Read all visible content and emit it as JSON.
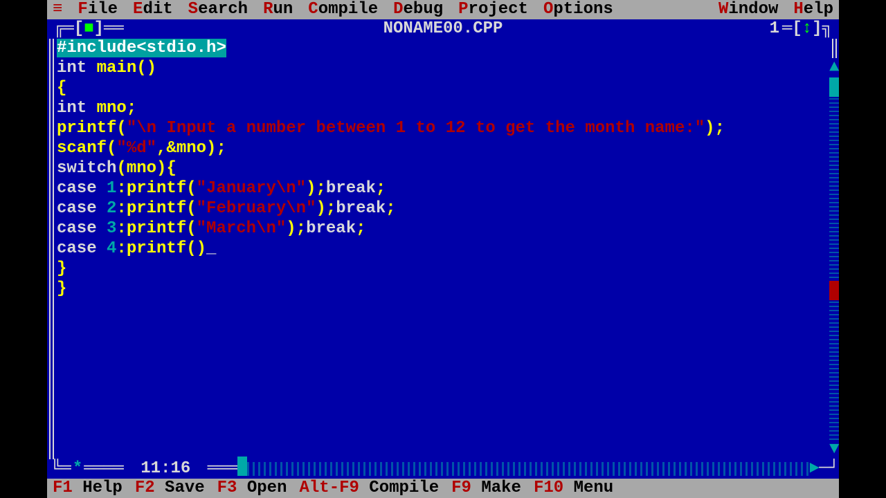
{
  "menu": {
    "items": [
      {
        "hot": "F",
        "rest": "ile"
      },
      {
        "hot": "E",
        "rest": "dit"
      },
      {
        "hot": "S",
        "rest": "earch"
      },
      {
        "hot": "R",
        "rest": "un"
      },
      {
        "hot": "C",
        "rest": "ompile"
      },
      {
        "hot": "D",
        "rest": "ebug"
      },
      {
        "hot": "P",
        "rest": "roject"
      },
      {
        "hot": "O",
        "rest": "ptions"
      }
    ],
    "right": [
      {
        "hot": "W",
        "rest": "indow"
      },
      {
        "hot": "H",
        "rest": "elp"
      }
    ]
  },
  "window": {
    "title": "NONAME00.CPP",
    "number": "1",
    "cursor_pos": "11:16"
  },
  "code": {
    "l0": {
      "text": "#include<stdio.h>"
    },
    "l1": {
      "kw": "int",
      "fn": "main",
      "sym": "()"
    },
    "l2": {
      "sym": "{"
    },
    "l3": {
      "kw": "int",
      "id": "mno",
      "sym": ";"
    },
    "l4": {
      "fn": "printf",
      "p1": "(",
      "s": "\"\\n Input a number between 1 to 12 to get the month name:\"",
      "p2": ");"
    },
    "l5": {
      "fn": "scanf",
      "p1": "(",
      "s": "\"%d\"",
      "mid": ",&mno);"
    },
    "l6": {
      "kw": "switch",
      "p1": "(",
      "id": "mno",
      "p2": "){"
    },
    "l7": {
      "kw": "case ",
      "n": "1",
      "mid": ":printf(",
      "s": "\"January\\n\"",
      "tail": ");",
      "br": "break",
      "semi": ";"
    },
    "l8": {
      "kw": "case ",
      "n": "2",
      "mid": ":printf(",
      "s": "\"February\\n\"",
      "tail": ");",
      "br": "break",
      "semi": ";"
    },
    "l9": {
      "kw": "case ",
      "n": "3",
      "mid": ":printf(",
      "s": "\"March\\n\"",
      "tail": ");",
      "br": "break",
      "semi": ";"
    },
    "l10": {
      "kw": "case ",
      "n": "4",
      "mid": ":printf()"
    },
    "l11": {
      "sym": "}"
    },
    "l12": {
      "sym": "}"
    }
  },
  "status": [
    {
      "key": "F1",
      "label": " Help"
    },
    {
      "key": "F2",
      "label": " Save"
    },
    {
      "key": "F3",
      "label": " Open"
    },
    {
      "key": "Alt-F9",
      "label": " Compile"
    },
    {
      "key": "F9",
      "label": " Make"
    },
    {
      "key": "F10",
      "label": " Menu"
    }
  ]
}
